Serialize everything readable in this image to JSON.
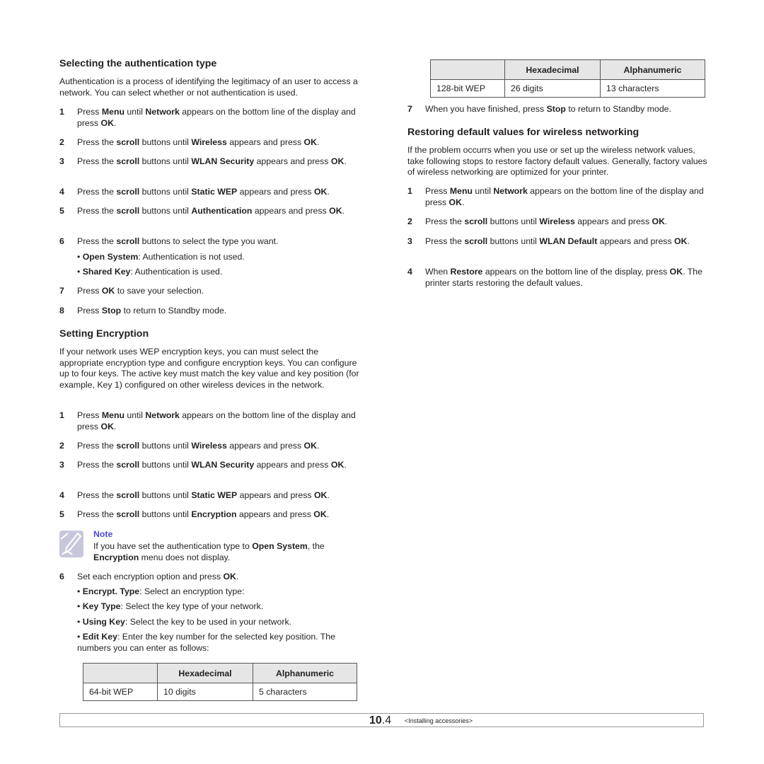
{
  "left": {
    "auth": {
      "heading": "Selecting the authentication type",
      "intro": "Authentication is a process of identifying the legitimacy of an user to access a network. You can select whether or not authentication is used.",
      "steps": [
        {
          "num": "1",
          "html": "Press <b>Menu</b> until <b>Network</b> appears on the bottom line of the display and press <b>OK</b>."
        },
        {
          "num": "2",
          "html": "Press the <b>scroll</b> buttons until <b>Wireless</b> appears and press <b>OK</b>."
        },
        {
          "num": "3",
          "html": "Press the <b>scroll</b> buttons until <b>WLAN Security</b> appears and press <b>OK</b>."
        },
        {
          "num": "4",
          "html": "Press the <b>scroll</b> buttons until <b>Static WEP</b> appears and press <b>OK</b>."
        },
        {
          "num": "5",
          "html": "Press the <b>scroll</b> buttons until <b>Authentication</b> appears and press <b>OK</b>."
        },
        {
          "num": "6",
          "html": "Press the <b>scroll</b> buttons to select the type you want."
        },
        {
          "num": "7",
          "html": "Press <b>OK</b> to save your selection."
        },
        {
          "num": "8",
          "html": "Press <b>Stop</b> to return to Standby mode."
        }
      ],
      "bullets": [
        {
          "term": "Open System",
          "desc": ": Authentication is not used."
        },
        {
          "term": "Shared Key",
          "desc": ": Authentication is used."
        }
      ]
    },
    "enc": {
      "heading": "Setting Encryption",
      "intro": "If your network uses WEP encryption keys, you can must select the appropriate encryption type and configure encryption keys. You can configure up to four keys. The active key must match the key value and key position (for example, Key 1) configured on other wireless devices in the network.",
      "steps": [
        {
          "num": "1",
          "html": "Press <b>Menu</b> until <b>Network</b> appears on the bottom line of the display and press <b>OK</b>."
        },
        {
          "num": "2",
          "html": "Press the <b>scroll</b> buttons until <b>Wireless</b> appears and press <b>OK</b>."
        },
        {
          "num": "3",
          "html": "Press the <b>scroll</b> buttons until <b>WLAN Security</b> appears and press <b>OK</b>."
        },
        {
          "num": "4",
          "html": "Press the <b>scroll</b> buttons until <b>Static WEP</b> appears and press <b>OK</b>."
        },
        {
          "num": "5",
          "html": "Press the <b>scroll</b> buttons until <b>Encryption</b> appears and press <b>OK</b>."
        },
        {
          "num": "6",
          "html": "Set each encryption option and press <b>OK</b>."
        }
      ],
      "note": {
        "title": "Note",
        "html": "If you have set the authentication type to <b>Open System</b>, the <b>Encryption</b> menu does not display."
      },
      "bullets": [
        {
          "term": "Encrypt. Type",
          "desc": ": Select an encryption type:"
        },
        {
          "term": "Key Type",
          "desc": ": Select the key type of your network."
        },
        {
          "term": "Using Key",
          "desc": ": Select the key to be used in your network."
        },
        {
          "term": "Edit Key",
          "desc": ": Enter the key number for the selected key position. The numbers you can enter as follows:"
        }
      ],
      "table": {
        "headers": [
          "",
          "Hexadecimal",
          "Alphanumeric"
        ],
        "rows": [
          [
            "64-bit WEP",
            "10 digits",
            "5 characters"
          ]
        ]
      }
    }
  },
  "right": {
    "table": {
      "headers": [
        "",
        "Hexadecimal",
        "Alphanumeric"
      ],
      "rows": [
        [
          "128-bit WEP",
          "26 digits",
          "13 characters"
        ]
      ]
    },
    "step7": {
      "num": "7",
      "html": "When you have finished, press <b>Stop</b> to return to Standby mode."
    },
    "restore": {
      "heading": "Restoring default values for wireless networking",
      "intro": "If the problem occurrs when you use or set up the wireless network values, take following stops to restore factory default values. Generally, factory values of wireless networking are optimized for your printer.",
      "steps": [
        {
          "num": "1",
          "html": "Press <b>Menu</b> until <b>Network</b> appears on the bottom line of the display and press <b>OK</b>."
        },
        {
          "num": "2",
          "html": "Press the <b>scroll</b> buttons until <b>Wireless</b> appears and press <b>OK</b>."
        },
        {
          "num": "3",
          "html": "Press the <b>scroll</b> buttons until <b>WLAN Default</b> appears and press <b>OK</b>."
        },
        {
          "num": "4",
          "html": "When  <b>Restore</b> appears on the bottom line of the display, press <b>OK</b>. The printer starts restoring the default values."
        }
      ]
    }
  },
  "footer": {
    "chapter": "10",
    "page": ".4",
    "section": "<Installing accessories>"
  },
  "colors": {
    "note_title": "#4a4adf",
    "table_header_bg": "#e6e6e6"
  }
}
